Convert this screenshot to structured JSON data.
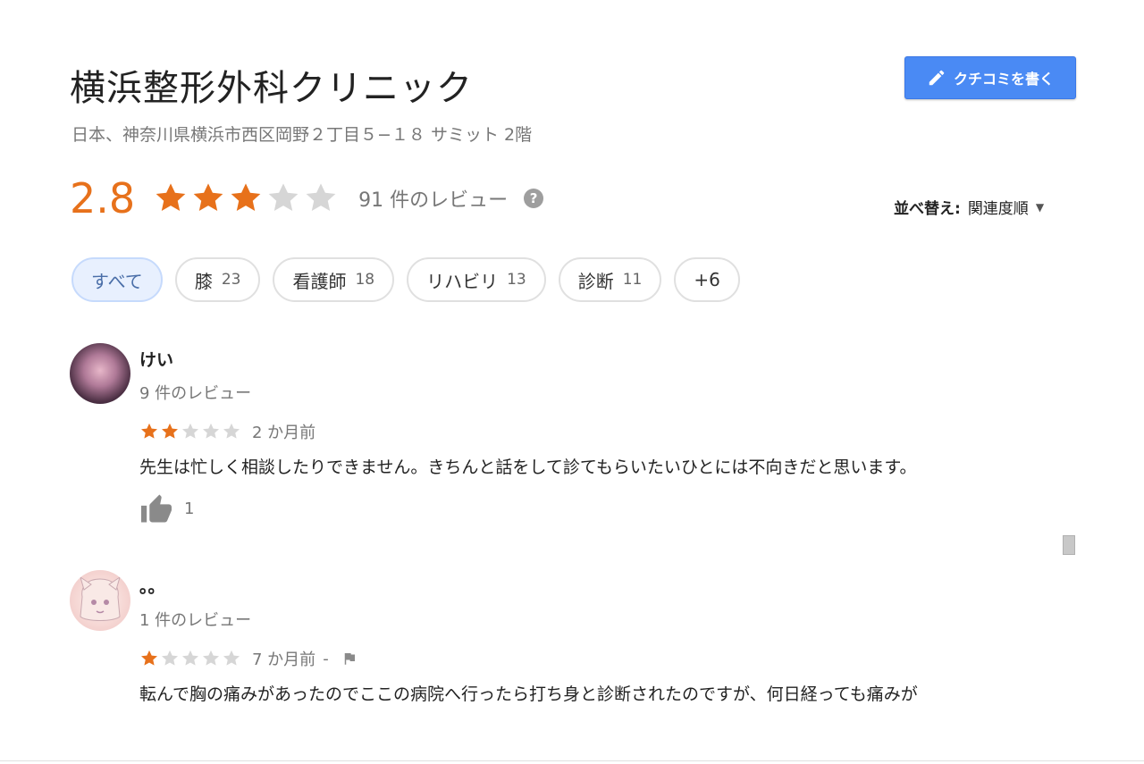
{
  "place": {
    "title": "横浜整形外科クリニック",
    "address": "日本、神奈川県横浜市西区岡野２丁目５−１８ サミット 2階"
  },
  "write_review": {
    "label": "クチコミを書く",
    "icon": "pencil-icon"
  },
  "summary": {
    "rating": "2.8",
    "rating_value": 2.8,
    "stars_filled": 3,
    "stars_total": 5,
    "review_count": "91 件のレビュー",
    "help": "?"
  },
  "sort": {
    "label": "並べ替え:",
    "value": "関連度順"
  },
  "filters": [
    {
      "label": "すべて",
      "count": "",
      "active": true
    },
    {
      "label": "膝",
      "count": "23",
      "active": false
    },
    {
      "label": "看護師",
      "count": "18",
      "active": false
    },
    {
      "label": "リハビリ",
      "count": "13",
      "active": false
    },
    {
      "label": "診断",
      "count": "11",
      "active": false
    },
    {
      "label": "+6",
      "count": "",
      "active": false
    }
  ],
  "reviews": [
    {
      "name": "けい",
      "meta": "9 件のレビュー",
      "stars": 2,
      "time": "2 か月前",
      "text": "先生は忙しく相談したりできません。きちんと話をして診てもらいたいひとには不向きだと思います。",
      "likes": "1"
    },
    {
      "name": "。。",
      "meta": "1 件のレビュー",
      "stars": 1,
      "time": "7 か月前",
      "separator": "-",
      "text": "転んで胸の痛みがあったのでここの病院へ行ったら打ち身と診断されたのですが、何日経っても痛みが"
    }
  ],
  "colors": {
    "star_filled": "#e7711b",
    "star_empty": "#d6d6d6",
    "accent": "#4a8af4",
    "chip_active_bg": "#e8f0fe"
  }
}
